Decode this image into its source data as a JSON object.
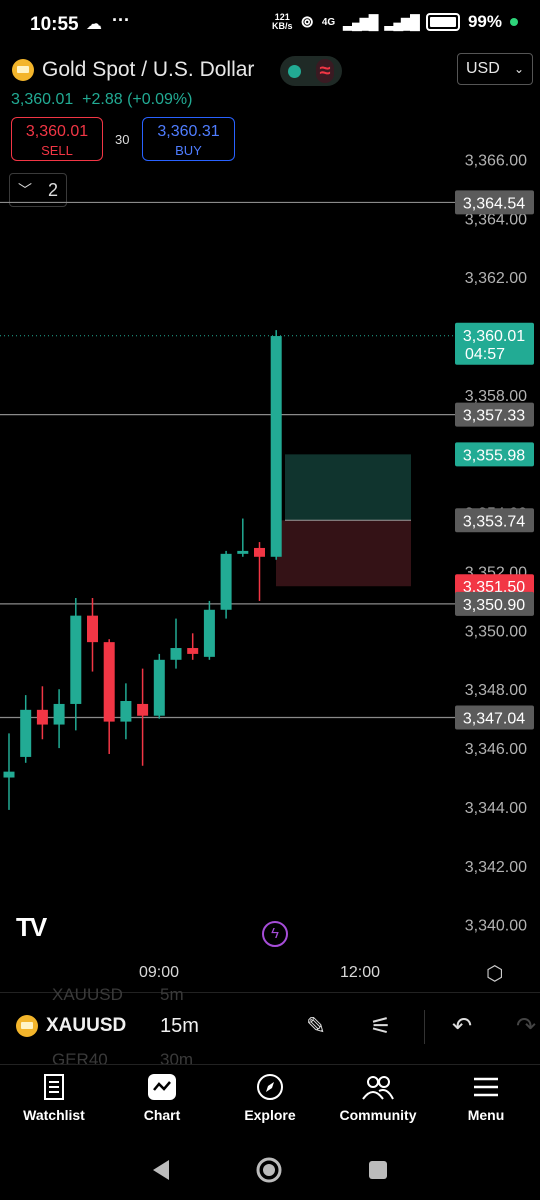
{
  "status_bar": {
    "time": "10:55",
    "net_speed_value": "121",
    "net_speed_unit": "KB/s",
    "network": "4G",
    "battery": "99%"
  },
  "header": {
    "title": "Gold Spot / U.S. Dollar",
    "currency": "USD",
    "quote": "3,360.01  +2.88 (+0.09%)",
    "sell": {
      "price": "3,360.01",
      "label": "SELL"
    },
    "buy": {
      "price": "3,360.31",
      "label": "BUY"
    },
    "spread": "30",
    "collapse_count": "2"
  },
  "chart_data": {
    "type": "candlestick",
    "y_ticks": [
      3366.0,
      3364.0,
      3362.0,
      3360.0,
      3358.0,
      3354.0,
      3352.0,
      3350.0,
      3348.0,
      3346.0,
      3344.0,
      3342.0,
      3340.0
    ],
    "y_tick_labels": [
      "3,366.00",
      "3,364.00",
      "3,362.00",
      "3,360.00",
      "3,358.00",
      "3,354.00",
      "3,352.00",
      "3,350.00",
      "3,348.00",
      "3,346.00",
      "3,344.00",
      "3,342.00",
      "3,340.00"
    ],
    "ylim": [
      3338.8,
      3368.7
    ],
    "x_ticks": [
      "09:00",
      "12:00"
    ],
    "candles": [
      {
        "o": 3345.0,
        "h": 3346.5,
        "l": 3343.9,
        "c": 3345.2
      },
      {
        "o": 3345.7,
        "h": 3347.8,
        "l": 3345.5,
        "c": 3347.3
      },
      {
        "o": 3347.3,
        "h": 3348.1,
        "l": 3346.3,
        "c": 3346.8
      },
      {
        "o": 3346.8,
        "h": 3348.0,
        "l": 3346.0,
        "c": 3347.5
      },
      {
        "o": 3347.5,
        "h": 3351.1,
        "l": 3346.6,
        "c": 3350.5
      },
      {
        "o": 3350.5,
        "h": 3351.1,
        "l": 3348.6,
        "c": 3349.6
      },
      {
        "o": 3349.6,
        "h": 3349.7,
        "l": 3345.8,
        "c": 3346.9
      },
      {
        "o": 3346.9,
        "h": 3348.2,
        "l": 3346.3,
        "c": 3347.6
      },
      {
        "o": 3347.5,
        "h": 3348.7,
        "l": 3345.4,
        "c": 3347.1
      },
      {
        "o": 3347.1,
        "h": 3349.2,
        "l": 3347.0,
        "c": 3349.0
      },
      {
        "o": 3349.0,
        "h": 3350.4,
        "l": 3348.7,
        "c": 3349.4
      },
      {
        "o": 3349.4,
        "h": 3349.9,
        "l": 3349.0,
        "c": 3349.2
      },
      {
        "o": 3349.1,
        "h": 3351.0,
        "l": 3349.0,
        "c": 3350.7
      },
      {
        "o": 3350.7,
        "h": 3352.7,
        "l": 3350.4,
        "c": 3352.6
      },
      {
        "o": 3352.6,
        "h": 3353.8,
        "l": 3352.5,
        "c": 3352.7
      },
      {
        "o": 3352.8,
        "h": 3353.0,
        "l": 3351.0,
        "c": 3352.5
      },
      {
        "o": 3352.5,
        "h": 3360.2,
        "l": 3352.4,
        "c": 3360.0
      }
    ],
    "position": {
      "entry": 3353.74,
      "take_profit": 3355.98,
      "stop_loss": 3351.5
    },
    "horizontal_lines": [
      3364.54,
      3357.33,
      3350.9,
      3347.04
    ],
    "current_price": 3360.01,
    "countdown": "04:57",
    "price_tags": [
      {
        "label": "3,364.54",
        "value": 3364.54,
        "color": "#5b5b5b"
      },
      {
        "label": "3,360.01",
        "value": 3360.01,
        "color": "#22ab94",
        "sub": "04:57"
      },
      {
        "label": "3,357.33",
        "value": 3357.33,
        "color": "#5b5b5b"
      },
      {
        "label": "3,355.98",
        "value": 3355.98,
        "color": "#22ab94"
      },
      {
        "label": "3,353.74",
        "value": 3353.74,
        "color": "#5b5b5b"
      },
      {
        "label": "3,351.50",
        "value": 3351.5,
        "color": "#f23645"
      },
      {
        "label": "3,350.90",
        "value": 3350.9,
        "color": "#5b5b5b"
      },
      {
        "label": "3,347.04",
        "value": 3347.04,
        "color": "#5b5b5b"
      }
    ],
    "colors": {
      "up": "#22ab94",
      "down": "#f23645"
    }
  },
  "toolbar": {
    "symbol": "XAUUSD",
    "timeframe": "15m",
    "ghost_above_symbol": "XAUUSD",
    "ghost_above_tf": "5m",
    "ghost_below_symbol": "GER40",
    "ghost_below_tf": "30m"
  },
  "nav": [
    {
      "label": "Watchlist",
      "icon": "watchlist-icon"
    },
    {
      "label": "Chart",
      "icon": "chart-icon"
    },
    {
      "label": "Explore",
      "icon": "compass-icon"
    },
    {
      "label": "Community",
      "icon": "people-icon"
    },
    {
      "label": "Menu",
      "icon": "menu-icon"
    }
  ]
}
